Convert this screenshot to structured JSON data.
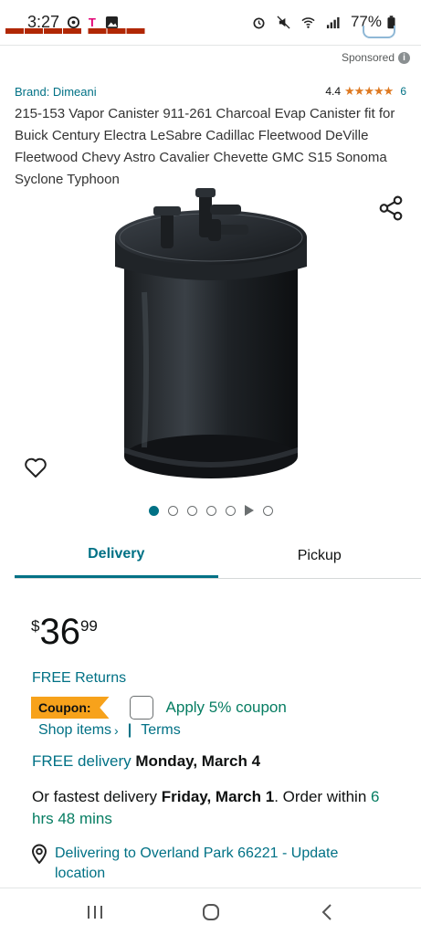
{
  "status_bar": {
    "time": "3:27",
    "battery": "77%",
    "icons": [
      "clock-icon",
      "t-mobile-icon",
      "image-icon",
      "alarm-icon",
      "mute-icon",
      "wifi-icon",
      "signal-icon",
      "battery-icon"
    ]
  },
  "sponsored": {
    "label": "Sponsored",
    "icon": "info-icon"
  },
  "product": {
    "brand": "Brand: Dimeani",
    "rating_value": "4.4",
    "stars": "★★★★★",
    "rating_count": "6",
    "title": "215-153 Vapor Canister 911-261 Charcoal Evap Canister fit for Buick Century Electra LeSabre Cadillac Fleetwood DeVille Fleetwood Chevy Astro Cavalier Chevette GMC S15 Sonoma Syclone Typhoon",
    "image_count": 6,
    "active_image": 1
  },
  "tabs": [
    {
      "label": "Delivery",
      "active": true
    },
    {
      "label": "Pickup",
      "active": false
    }
  ],
  "price": {
    "symbol": "$",
    "whole": "36",
    "fraction": "99"
  },
  "free_returns": "FREE Returns",
  "coupon": {
    "badge": "Coupon:",
    "apply_label": "Apply 5% coupon",
    "checked": false,
    "shop_items": "Shop items",
    "shop_chevron": "›",
    "separator": "|",
    "terms": "Terms"
  },
  "delivery": {
    "free_label": "FREE delivery",
    "date": "Monday, March 4",
    "fastest_prefix": "Or fastest delivery",
    "fastest_date": "Friday, March 1",
    "order_within_prefix": ". Order within",
    "countdown": "6 hrs 48 mins",
    "location": "Delivering to Overland Park 66221 - Update location"
  },
  "colors": {
    "link": "#007185",
    "green": "#067d62",
    "coupon_badge": "#f7a21b",
    "stars": "#de7921",
    "price_strip": "#b12704"
  }
}
